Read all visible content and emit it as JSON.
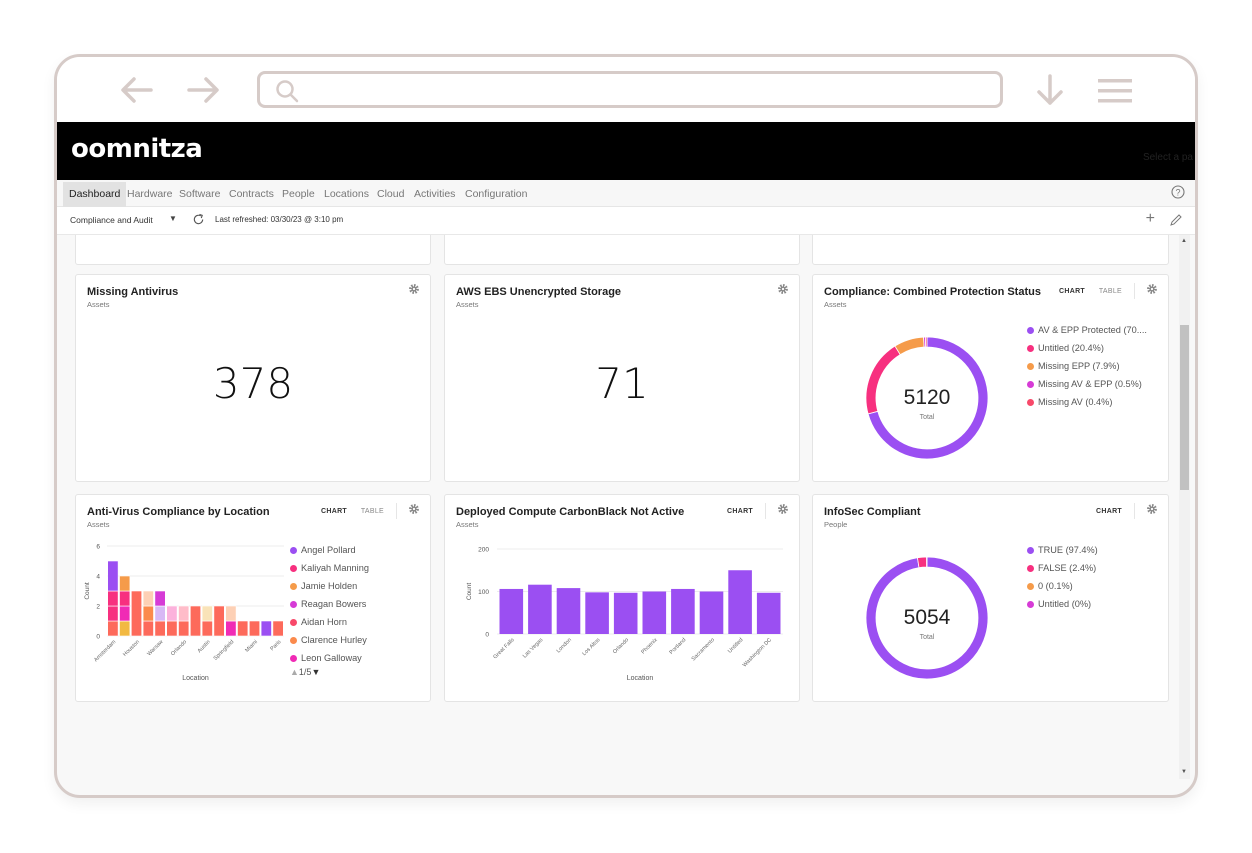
{
  "browser": {
    "url_value": "",
    "icons": {
      "back": "arrow-left-icon",
      "forward": "arrow-right-icon",
      "search": "search-icon",
      "download": "arrow-down-icon",
      "menu": "hamburger-menu-icon"
    }
  },
  "app": {
    "logo": "oomnitza",
    "header_right_text": "Select a pa"
  },
  "nav": {
    "tabs": [
      {
        "label": "Dashboard",
        "active": true
      },
      {
        "label": "Hardware",
        "active": false
      },
      {
        "label": "Software",
        "active": false
      },
      {
        "label": "Contracts",
        "active": false
      },
      {
        "label": "People",
        "active": false
      },
      {
        "label": "Locations",
        "active": false
      },
      {
        "label": "Cloud",
        "active": false
      },
      {
        "label": "Activities",
        "active": false
      },
      {
        "label": "Configuration",
        "active": false
      }
    ]
  },
  "toolbar": {
    "dashboard_selected": "Compliance and Audit",
    "last_refreshed": "Last refreshed: 03/30/23 @ 3:10 pm"
  },
  "colors": {
    "purple": "#9b4ff2",
    "pink": "#f7307f",
    "orange": "#f59b4a",
    "magenta": "#d63bd6",
    "red": "#f8496a",
    "coral": "#fd6a5b",
    "gold": "#f2b942",
    "peach": "#fdd0b5",
    "lavender": "#d8b8f5",
    "lightpink": "#fcb2dc",
    "rose": "#ffbcc9",
    "cream": "#f9e3b8",
    "bar_orange": "#fb8a4c"
  },
  "cards": {
    "missing_antivirus": {
      "title": "Missing Antivirus",
      "subtitle": "Assets",
      "value": "378"
    },
    "aws_ebs": {
      "title": "AWS EBS Unencrypted Storage",
      "subtitle": "Assets",
      "value": "71"
    },
    "combined_protection": {
      "title": "Compliance: Combined Protection Status",
      "subtitle": "Assets",
      "chart_btn": "CHART",
      "table_btn": "TABLE",
      "total": "5120",
      "total_label": "Total",
      "legend": [
        {
          "label": "AV & EPP Protected (70....",
          "color": "#9b4ff2"
        },
        {
          "label": "Untitled (20.4%)",
          "color": "#f7307f"
        },
        {
          "label": "Missing EPP (7.9%)",
          "color": "#f59b4a"
        },
        {
          "label": "Missing AV & EPP (0.5%)",
          "color": "#d63bd6"
        },
        {
          "label": "Missing AV (0.4%)",
          "color": "#f8496a"
        }
      ]
    },
    "av_by_location": {
      "title": "Anti-Virus Compliance by Location",
      "subtitle": "Assets",
      "chart_btn": "CHART",
      "table_btn": "TABLE",
      "legend": [
        {
          "label": "Angel Pollard",
          "color": "#9b4ff2"
        },
        {
          "label": "Kaliyah Manning",
          "color": "#f7307f"
        },
        {
          "label": "Jamie Holden",
          "color": "#f59b4a"
        },
        {
          "label": "Reagan Bowers",
          "color": "#d63bd6"
        },
        {
          "label": "Aidan Horn",
          "color": "#f8496a"
        },
        {
          "label": "Clarence Hurley",
          "color": "#fb8a4c"
        },
        {
          "label": "Leon Galloway",
          "color": "#f02bb5"
        }
      ],
      "pager": {
        "up": "▲",
        "text": "1/5",
        "down": "▼"
      }
    },
    "carbonblack": {
      "title": "Deployed Compute CarbonBlack Not Active",
      "subtitle": "Assets",
      "chart_btn": "CHART"
    },
    "infosec": {
      "title": "InfoSec Compliant",
      "subtitle": "People",
      "chart_btn": "CHART",
      "total": "5054",
      "total_label": "Total",
      "legend": [
        {
          "label": "TRUE (97.4%)",
          "color": "#9b4ff2"
        },
        {
          "label": "FALSE (2.4%)",
          "color": "#f7307f"
        },
        {
          "label": "0 (0.1%)",
          "color": "#f59b4a"
        },
        {
          "label": "Untitled (0%)",
          "color": "#d63bd6"
        }
      ]
    }
  },
  "chart_data": [
    {
      "id": "combined_protection",
      "type": "pie",
      "title": "Compliance: Combined Protection Status",
      "donut": true,
      "center_label": "5120 Total",
      "categories": [
        "AV & EPP Protected",
        "Untitled",
        "Missing EPP",
        "Missing AV & EPP",
        "Missing AV"
      ],
      "values": [
        70.8,
        20.4,
        7.9,
        0.5,
        0.4
      ],
      "colors": [
        "#9b4ff2",
        "#f7307f",
        "#f59b4a",
        "#d63bd6",
        "#f8496a"
      ]
    },
    {
      "id": "infosec",
      "type": "pie",
      "title": "InfoSec Compliant",
      "donut": true,
      "center_label": "5054 Total",
      "categories": [
        "TRUE",
        "FALSE",
        "0",
        "Untitled"
      ],
      "values": [
        97.4,
        2.4,
        0.1,
        0
      ],
      "colors": [
        "#9b4ff2",
        "#f7307f",
        "#f59b4a",
        "#d63bd6"
      ]
    },
    {
      "id": "av_by_location",
      "type": "bar",
      "stacked": true,
      "title": "Anti-Virus Compliance by Location",
      "xlabel": "Location",
      "ylabel": "Count",
      "ylim": [
        0,
        6
      ],
      "yticks": [
        0,
        2,
        4,
        6
      ],
      "categories": [
        "Amsterdam",
        "",
        "Houston",
        "",
        "Warsaw",
        "",
        "Orlando",
        "",
        "Austin",
        "",
        "Springfield",
        "",
        "Miami",
        "",
        "Paris"
      ],
      "stacks": [
        [
          [
            "#fd6a5b",
            1
          ],
          [
            "#f7307f",
            1
          ],
          [
            "#f7307f",
            1
          ],
          [
            "#9b4ff2",
            2
          ]
        ],
        [
          [
            "#f2b942",
            1
          ],
          [
            "#f02bb5",
            1
          ],
          [
            "#f7307f",
            1
          ],
          [
            "#f59b4a",
            1
          ]
        ],
        [
          [
            "#fd6a5b",
            3
          ]
        ],
        [
          [
            "#fd6a5b",
            1
          ],
          [
            "#fb8a4c",
            1
          ],
          [
            "#fdd0b5",
            1
          ]
        ],
        [
          [
            "#fd6a5b",
            1
          ],
          [
            "#d8b8f5",
            1
          ],
          [
            "#d63bd6",
            1
          ]
        ],
        [
          [
            "#fd6a5b",
            1
          ],
          [
            "#fcb2dc",
            1
          ]
        ],
        [
          [
            "#fd6a5b",
            1
          ],
          [
            "#ffbcc9",
            1
          ]
        ],
        [
          [
            "#fd6a5b",
            2
          ]
        ],
        [
          [
            "#fd6a5b",
            1
          ],
          [
            "#f9e3b8",
            1
          ]
        ],
        [
          [
            "#fd6a5b",
            2
          ]
        ],
        [
          [
            "#f02bb5",
            1
          ],
          [
            "#fdd0b5",
            1
          ]
        ],
        [
          [
            "#fd6a5b",
            1
          ]
        ],
        [
          [
            "#fd6a5b",
            1
          ]
        ],
        [
          [
            "#9b4ff2",
            1
          ]
        ],
        [
          [
            "#fd6a5b",
            1
          ]
        ]
      ],
      "totals": [
        5,
        4,
        3,
        3,
        3,
        2,
        2,
        2,
        2,
        2,
        2,
        1,
        1,
        1,
        1
      ]
    },
    {
      "id": "carbonblack",
      "type": "bar",
      "title": "Deployed Compute CarbonBlack Not Active",
      "xlabel": "Location",
      "ylabel": "Count",
      "ylim": [
        0,
        200
      ],
      "yticks": [
        0,
        100,
        200
      ],
      "categories": [
        "Great Falls",
        "Las Vegas",
        "London",
        "Los Altos",
        "Orlando",
        "Phoenix",
        "Portland",
        "Sacramento",
        "Untitled",
        "Washington DC"
      ],
      "values": [
        106,
        116,
        108,
        98,
        97,
        100,
        106,
        100,
        150,
        97
      ],
      "color": "#9b4ff2"
    }
  ]
}
